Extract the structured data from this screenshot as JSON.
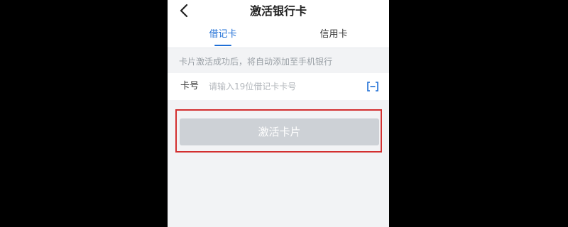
{
  "header": {
    "title": "激活银行卡",
    "back_icon": "chevron-left-icon"
  },
  "tabs": [
    {
      "label": "借记卡",
      "active": true
    },
    {
      "label": "信用卡",
      "active": false
    }
  ],
  "hint": "卡片激活成功后，将自动添加至手机银行",
  "card_field": {
    "label": "卡号",
    "placeholder": "请输入19位借记卡卡号",
    "value": "",
    "scan_icon": "scan-icon"
  },
  "actions": {
    "activate_label": "激活卡片"
  },
  "colors": {
    "accent": "#1f6fd6",
    "button_disabled": "#cdd1d6",
    "highlight": "#d32f2f",
    "background": "#f2f3f5"
  }
}
